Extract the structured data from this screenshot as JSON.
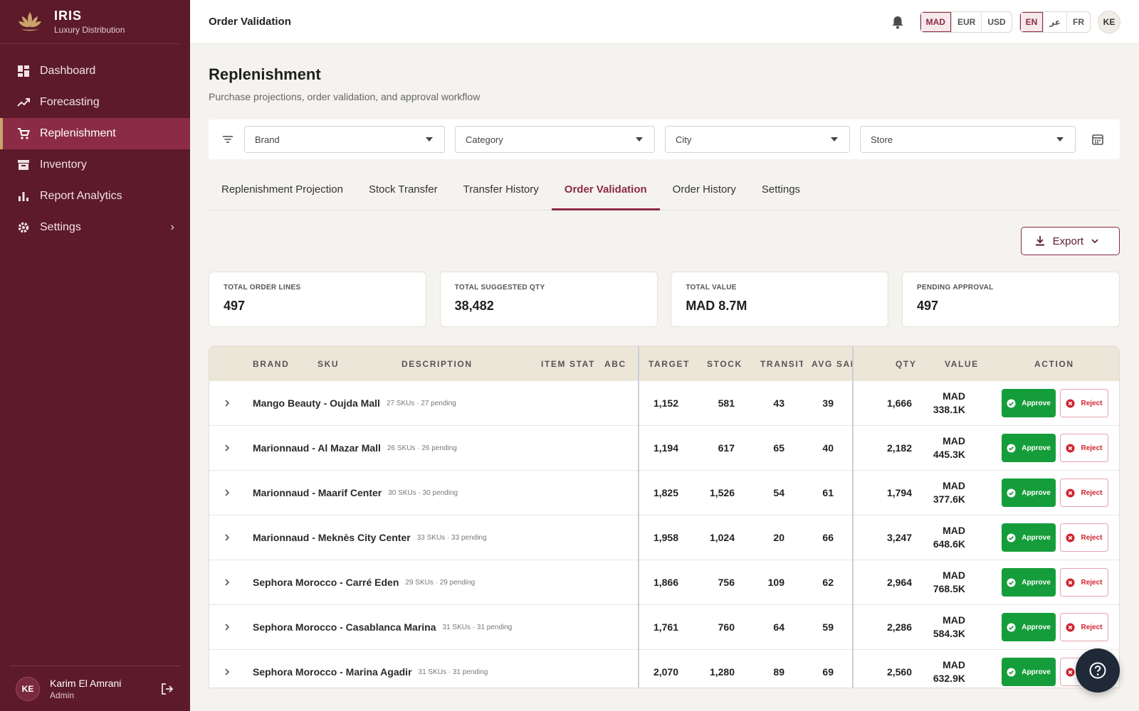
{
  "brand": {
    "title": "IRIS",
    "subtitle": "Luxury Distribution"
  },
  "sidebar": {
    "items": [
      {
        "label": "Dashboard",
        "icon": "dashboard-icon"
      },
      {
        "label": "Forecasting",
        "icon": "trending-icon"
      },
      {
        "label": "Replenishment",
        "icon": "cart-icon",
        "active": true
      },
      {
        "label": "Inventory",
        "icon": "archive-icon"
      },
      {
        "label": "Report Analytics",
        "icon": "bar-chart-icon"
      },
      {
        "label": "Settings",
        "icon": "gear-icon"
      }
    ]
  },
  "user": {
    "initials": "KE",
    "name": "Karim El Amrani",
    "role": "Admin"
  },
  "topbar": {
    "title": "Order Validation",
    "currencies": [
      "MAD",
      "EUR",
      "USD"
    ],
    "currency_selected": "MAD",
    "languages": [
      "EN",
      "عر",
      "FR"
    ],
    "language_selected": "EN",
    "avatar": "KE"
  },
  "page": {
    "title": "Replenishment",
    "subtitle": "Purchase projections, order validation, and approval workflow"
  },
  "filters": {
    "brand": "Brand",
    "category": "Category",
    "city": "City",
    "store": "Store"
  },
  "tabs": [
    "Replenishment Projection",
    "Stock Transfer",
    "Transfer History",
    "Order Validation",
    "Order History",
    "Settings"
  ],
  "export_label": "Export",
  "kpis": [
    {
      "label": "Total Order Lines",
      "value": "497"
    },
    {
      "label": "Total Suggested Qty",
      "value": "38,482"
    },
    {
      "label": "Total Value",
      "value": "MAD 8.7M"
    },
    {
      "label": "Pending Approval",
      "value": "497"
    }
  ],
  "table": {
    "headers": {
      "brand": "BRAND",
      "sku": "SKU",
      "description": "DESCRIPTION",
      "item_status": "ITEM STAT",
      "abc": "ABC",
      "target": "TARGET",
      "stock": "STOCK",
      "transit": "TRANSIT",
      "avg_sales": "AVG SAL",
      "qty": "QTY",
      "value": "VALUE",
      "action": "ACTION"
    },
    "approve_label": "Approve",
    "reject_label": "Reject",
    "rows": [
      {
        "name": "Mango Beauty - Oujda Mall",
        "meta": "27 SKUs · 27 pending",
        "target": "1,152",
        "stock": "581",
        "transit": "43",
        "avg": "39",
        "qty": "1,666",
        "cur": "MAD",
        "value": "338.1K"
      },
      {
        "name": "Marionnaud - Al Mazar Mall",
        "meta": "26 SKUs · 26 pending",
        "target": "1,194",
        "stock": "617",
        "transit": "65",
        "avg": "40",
        "qty": "2,182",
        "cur": "MAD",
        "value": "445.3K"
      },
      {
        "name": "Marionnaud - Maarif Center",
        "meta": "30 SKUs · 30 pending",
        "target": "1,825",
        "stock": "1,526",
        "transit": "54",
        "avg": "61",
        "qty": "1,794",
        "cur": "MAD",
        "value": "377.6K"
      },
      {
        "name": "Marionnaud - Meknès City Center",
        "meta": "33 SKUs · 33 pending",
        "target": "1,958",
        "stock": "1,024",
        "transit": "20",
        "avg": "66",
        "qty": "3,247",
        "cur": "MAD",
        "value": "648.6K"
      },
      {
        "name": "Sephora Morocco - Carré Eden",
        "meta": "29 SKUs · 29 pending",
        "target": "1,866",
        "stock": "756",
        "transit": "109",
        "avg": "62",
        "qty": "2,964",
        "cur": "MAD",
        "value": "768.5K"
      },
      {
        "name": "Sephora Morocco - Casablanca Marina",
        "meta": "31 SKUs · 31 pending",
        "target": "1,761",
        "stock": "760",
        "transit": "64",
        "avg": "59",
        "qty": "2,286",
        "cur": "MAD",
        "value": "584.3K"
      },
      {
        "name": "Sephora Morocco - Marina Agadir",
        "meta": "31 SKUs · 31 pending",
        "target": "2,070",
        "stock": "1,280",
        "transit": "89",
        "avg": "69",
        "qty": "2,560",
        "cur": "MAD",
        "value": "632.9K"
      }
    ]
  },
  "colors": {
    "sidebar": "#5c1a2b",
    "accent": "#8b2c44",
    "approve": "#169d3b",
    "reject": "#d0252f"
  }
}
